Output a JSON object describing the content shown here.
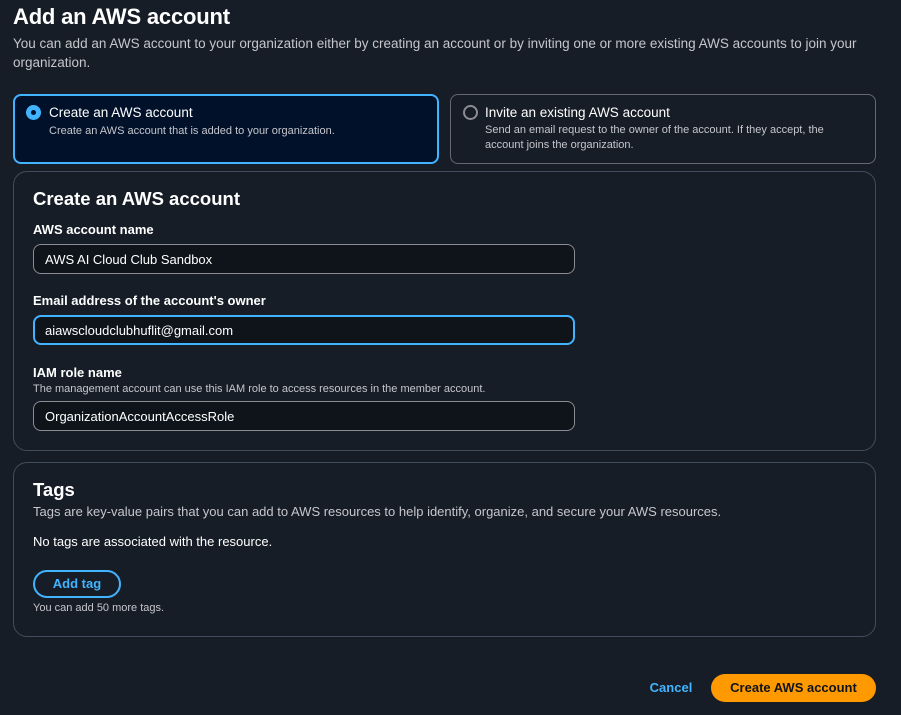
{
  "page": {
    "title": "Add an AWS account",
    "description": "You can add an AWS account to your organization either by creating an account or by inviting one or more existing AWS accounts to join your organization."
  },
  "options": {
    "create": {
      "label": "Create an AWS account",
      "description": "Create an AWS account that is added to your organization.",
      "selected": true
    },
    "invite": {
      "label": "Invite an existing AWS account",
      "description": "Send an email request to the owner of the account. If they accept, the account joins the organization.",
      "selected": false
    }
  },
  "create_form": {
    "heading": "Create an AWS account",
    "account_name": {
      "label": "AWS account name",
      "value": "AWS AI Cloud Club Sandbox"
    },
    "email": {
      "label": "Email address of the account's owner",
      "value": "aiawscloudclubhuflit@gmail.com"
    },
    "iam_role": {
      "label": "IAM role name",
      "hint": "The management account can use this IAM role to access resources in the member account.",
      "value": "OrganizationAccountAccessRole"
    }
  },
  "tags": {
    "heading": "Tags",
    "description": "Tags are key-value pairs that you can add to AWS resources to help identify, organize, and secure your AWS resources.",
    "empty_message": "No tags are associated with the resource.",
    "add_button": "Add tag",
    "limit_text": "You can add 50 more tags."
  },
  "footer": {
    "cancel_label": "Cancel",
    "submit_label": "Create AWS account"
  },
  "colors": {
    "background": "#161d26",
    "accent": "#42b4ff",
    "primary_button": "#ff9900"
  }
}
